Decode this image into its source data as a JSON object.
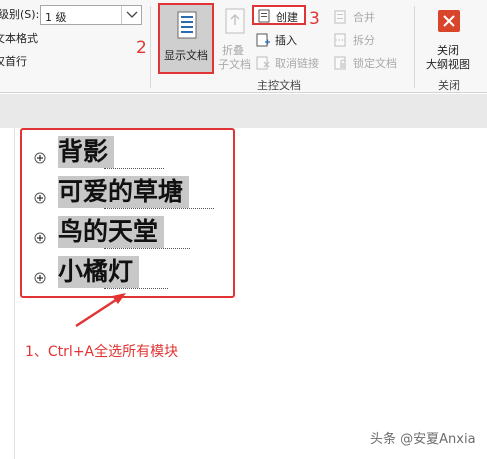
{
  "ribbon": {
    "level_label": "级别(S):",
    "level_value": "1 级",
    "show_text_format": "文本格式",
    "show_first_line": "仅首行",
    "show_document": "显示文档",
    "collapse_line1": "折叠",
    "collapse_line2": "子文档",
    "create": "创建",
    "insert": "插入",
    "unlink": "取消链接",
    "merge": "合并",
    "split": "拆分",
    "lock_document": "锁定文档",
    "master_group_label": "主控文档",
    "close_line1": "关闭",
    "close_line2": "大纲视图",
    "close_group_label": "关闭"
  },
  "annotations": {
    "step1": "1、Ctrl+A全选所有模块",
    "step2": "2",
    "step3": "3"
  },
  "outline": {
    "items": [
      "背影",
      "可爱的草塘",
      "鸟的天堂",
      "小橘灯"
    ]
  },
  "watermark": "头条 @安夏Anxia",
  "colors": {
    "annotation_red": "#e23434",
    "close_icon_bg": "#d8452b",
    "selection_gray": "#c8c8c8"
  },
  "icons": [
    "chevron-down-icon",
    "show-document-icon",
    "collapse-subdocument-icon",
    "create-icon",
    "insert-icon",
    "unlink-icon",
    "merge-icon",
    "split-icon",
    "lock-icon",
    "close-icon",
    "expand-plus-icon",
    "arrow-icon"
  ]
}
